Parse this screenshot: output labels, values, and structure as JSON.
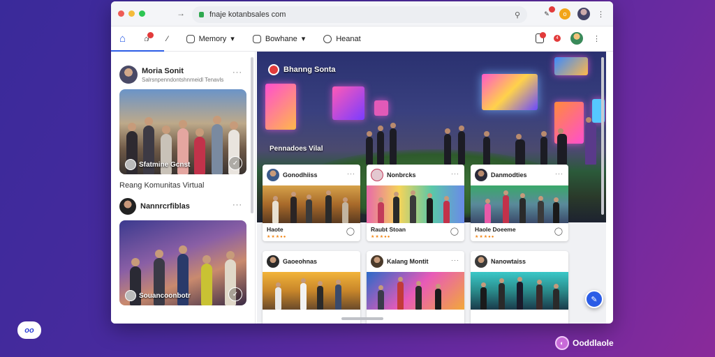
{
  "browser": {
    "url": "fnaje kotanbsales com"
  },
  "nav": {
    "items": [
      {
        "label": "Memory",
        "chevron": "▾"
      },
      {
        "label": "Bowhane",
        "chevron": "▾"
      },
      {
        "label": "Heanat",
        "chevron": ""
      }
    ]
  },
  "sidebar": {
    "posts": [
      {
        "name": "Moria Sonit",
        "subtitle": "Salrsnpenndontshnmeidl Tenavls",
        "caption": "Sfatmine Gcnst"
      },
      {
        "name": "Nannrcrfiblas",
        "subtitle": "",
        "caption": "Souancoonbotr"
      }
    ],
    "section_label": "Reang Komunitas Virtual"
  },
  "hero": {
    "title": "Bhanng Sonta",
    "subtitle": "Pennadoes Vilal"
  },
  "cards": [
    {
      "name": "Gonodhiiss",
      "title": "Haote"
    },
    {
      "name": "Nonbrcks",
      "title": "Raubt Stoan"
    },
    {
      "name": "Danmodties",
      "title": "Haole Doeeme"
    },
    {
      "name": "Gaoeohnas",
      "title": ""
    },
    {
      "name": "Kalang Montit",
      "title": ""
    },
    {
      "name": "Nanowtaiss",
      "title": ""
    }
  ],
  "branding": {
    "bottom_left": "oo",
    "bottom_right": "Ooddlaole"
  },
  "colors": {
    "accent": "#2b5ce6",
    "notification": "#e23b3b",
    "star": "#f28a1e"
  },
  "icons": [
    "home-icon",
    "notifications-icon",
    "edit-icon",
    "more-icon",
    "star-icon",
    "comment-icon"
  ]
}
